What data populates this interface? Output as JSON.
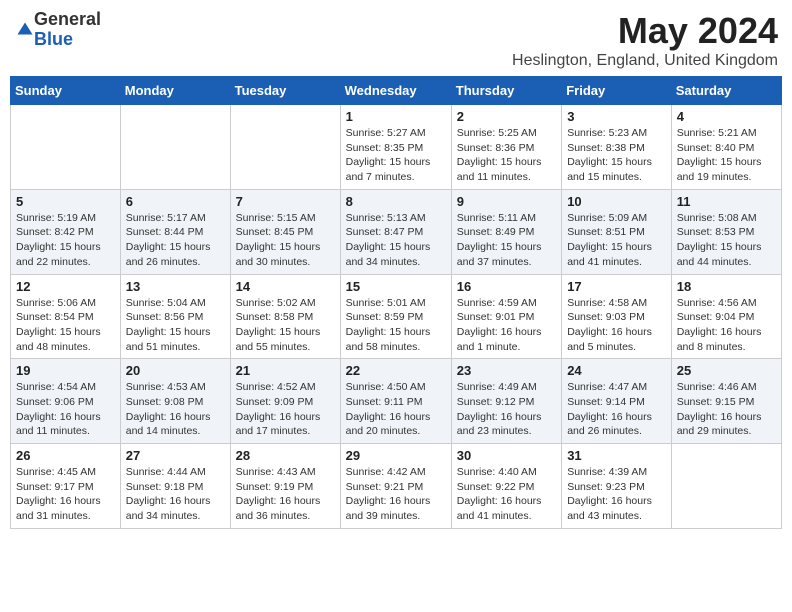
{
  "logo": {
    "general": "General",
    "blue": "Blue"
  },
  "title": "May 2024",
  "location": "Heslington, England, United Kingdom",
  "days_of_week": [
    "Sunday",
    "Monday",
    "Tuesday",
    "Wednesday",
    "Thursday",
    "Friday",
    "Saturday"
  ],
  "weeks": [
    [
      {
        "day": "",
        "info": ""
      },
      {
        "day": "",
        "info": ""
      },
      {
        "day": "",
        "info": ""
      },
      {
        "day": "1",
        "info": "Sunrise: 5:27 AM\nSunset: 8:35 PM\nDaylight: 15 hours\nand 7 minutes."
      },
      {
        "day": "2",
        "info": "Sunrise: 5:25 AM\nSunset: 8:36 PM\nDaylight: 15 hours\nand 11 minutes."
      },
      {
        "day": "3",
        "info": "Sunrise: 5:23 AM\nSunset: 8:38 PM\nDaylight: 15 hours\nand 15 minutes."
      },
      {
        "day": "4",
        "info": "Sunrise: 5:21 AM\nSunset: 8:40 PM\nDaylight: 15 hours\nand 19 minutes."
      }
    ],
    [
      {
        "day": "5",
        "info": "Sunrise: 5:19 AM\nSunset: 8:42 PM\nDaylight: 15 hours\nand 22 minutes."
      },
      {
        "day": "6",
        "info": "Sunrise: 5:17 AM\nSunset: 8:44 PM\nDaylight: 15 hours\nand 26 minutes."
      },
      {
        "day": "7",
        "info": "Sunrise: 5:15 AM\nSunset: 8:45 PM\nDaylight: 15 hours\nand 30 minutes."
      },
      {
        "day": "8",
        "info": "Sunrise: 5:13 AM\nSunset: 8:47 PM\nDaylight: 15 hours\nand 34 minutes."
      },
      {
        "day": "9",
        "info": "Sunrise: 5:11 AM\nSunset: 8:49 PM\nDaylight: 15 hours\nand 37 minutes."
      },
      {
        "day": "10",
        "info": "Sunrise: 5:09 AM\nSunset: 8:51 PM\nDaylight: 15 hours\nand 41 minutes."
      },
      {
        "day": "11",
        "info": "Sunrise: 5:08 AM\nSunset: 8:53 PM\nDaylight: 15 hours\nand 44 minutes."
      }
    ],
    [
      {
        "day": "12",
        "info": "Sunrise: 5:06 AM\nSunset: 8:54 PM\nDaylight: 15 hours\nand 48 minutes."
      },
      {
        "day": "13",
        "info": "Sunrise: 5:04 AM\nSunset: 8:56 PM\nDaylight: 15 hours\nand 51 minutes."
      },
      {
        "day": "14",
        "info": "Sunrise: 5:02 AM\nSunset: 8:58 PM\nDaylight: 15 hours\nand 55 minutes."
      },
      {
        "day": "15",
        "info": "Sunrise: 5:01 AM\nSunset: 8:59 PM\nDaylight: 15 hours\nand 58 minutes."
      },
      {
        "day": "16",
        "info": "Sunrise: 4:59 AM\nSunset: 9:01 PM\nDaylight: 16 hours\nand 1 minute."
      },
      {
        "day": "17",
        "info": "Sunrise: 4:58 AM\nSunset: 9:03 PM\nDaylight: 16 hours\nand 5 minutes."
      },
      {
        "day": "18",
        "info": "Sunrise: 4:56 AM\nSunset: 9:04 PM\nDaylight: 16 hours\nand 8 minutes."
      }
    ],
    [
      {
        "day": "19",
        "info": "Sunrise: 4:54 AM\nSunset: 9:06 PM\nDaylight: 16 hours\nand 11 minutes."
      },
      {
        "day": "20",
        "info": "Sunrise: 4:53 AM\nSunset: 9:08 PM\nDaylight: 16 hours\nand 14 minutes."
      },
      {
        "day": "21",
        "info": "Sunrise: 4:52 AM\nSunset: 9:09 PM\nDaylight: 16 hours\nand 17 minutes."
      },
      {
        "day": "22",
        "info": "Sunrise: 4:50 AM\nSunset: 9:11 PM\nDaylight: 16 hours\nand 20 minutes."
      },
      {
        "day": "23",
        "info": "Sunrise: 4:49 AM\nSunset: 9:12 PM\nDaylight: 16 hours\nand 23 minutes."
      },
      {
        "day": "24",
        "info": "Sunrise: 4:47 AM\nSunset: 9:14 PM\nDaylight: 16 hours\nand 26 minutes."
      },
      {
        "day": "25",
        "info": "Sunrise: 4:46 AM\nSunset: 9:15 PM\nDaylight: 16 hours\nand 29 minutes."
      }
    ],
    [
      {
        "day": "26",
        "info": "Sunrise: 4:45 AM\nSunset: 9:17 PM\nDaylight: 16 hours\nand 31 minutes."
      },
      {
        "day": "27",
        "info": "Sunrise: 4:44 AM\nSunset: 9:18 PM\nDaylight: 16 hours\nand 34 minutes."
      },
      {
        "day": "28",
        "info": "Sunrise: 4:43 AM\nSunset: 9:19 PM\nDaylight: 16 hours\nand 36 minutes."
      },
      {
        "day": "29",
        "info": "Sunrise: 4:42 AM\nSunset: 9:21 PM\nDaylight: 16 hours\nand 39 minutes."
      },
      {
        "day": "30",
        "info": "Sunrise: 4:40 AM\nSunset: 9:22 PM\nDaylight: 16 hours\nand 41 minutes."
      },
      {
        "day": "31",
        "info": "Sunrise: 4:39 AM\nSunset: 9:23 PM\nDaylight: 16 hours\nand 43 minutes."
      },
      {
        "day": "",
        "info": ""
      }
    ]
  ]
}
